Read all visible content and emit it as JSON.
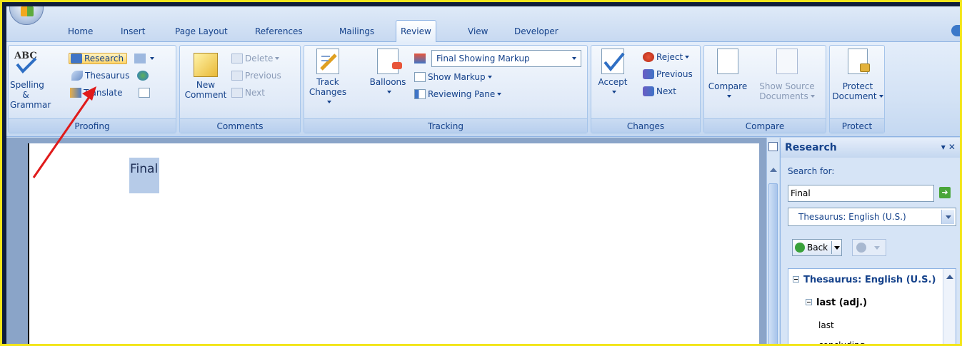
{
  "tabs": [
    "Home",
    "Insert",
    "Page Layout",
    "References",
    "Mailings",
    "Review",
    "View",
    "Developer"
  ],
  "active_tab": "Review",
  "proofing": {
    "group_label": "Proofing",
    "spelling_label_1": "Spelling &",
    "spelling_label_2": "Grammar",
    "research": "Research",
    "thesaurus": "Thesaurus",
    "translate": "Translate"
  },
  "comments": {
    "group_label": "Comments",
    "new_comment_1": "New",
    "new_comment_2": "Comment",
    "delete": "Delete",
    "previous": "Previous",
    "next": "Next"
  },
  "tracking": {
    "group_label": "Tracking",
    "track_changes_1": "Track",
    "track_changes_2": "Changes",
    "balloons": "Balloons",
    "display_mode": "Final Showing Markup",
    "show_markup": "Show Markup",
    "reviewing_pane": "Reviewing Pane"
  },
  "changes": {
    "group_label": "Changes",
    "accept": "Accept",
    "reject": "Reject",
    "previous": "Previous",
    "next": "Next"
  },
  "compare": {
    "group_label": "Compare",
    "compare": "Compare",
    "show_source_1": "Show Source",
    "show_source_2": "Documents"
  },
  "protect": {
    "group_label": "Protect",
    "protect_1": "Protect",
    "protect_2": "Document"
  },
  "document": {
    "selected_word": "Final"
  },
  "research_pane": {
    "title": "Research",
    "search_label": "Search for:",
    "search_value": "Final",
    "source": "Thesaurus: English (U.S.)",
    "back": "Back",
    "results": {
      "heading": "Thesaurus: English (U.S.)",
      "sense": "last (adj.)",
      "words": [
        "last",
        "concluding"
      ]
    }
  },
  "colors": {
    "annotation_arrow": "#e01b1b",
    "ribbon_text": "#15428b"
  }
}
